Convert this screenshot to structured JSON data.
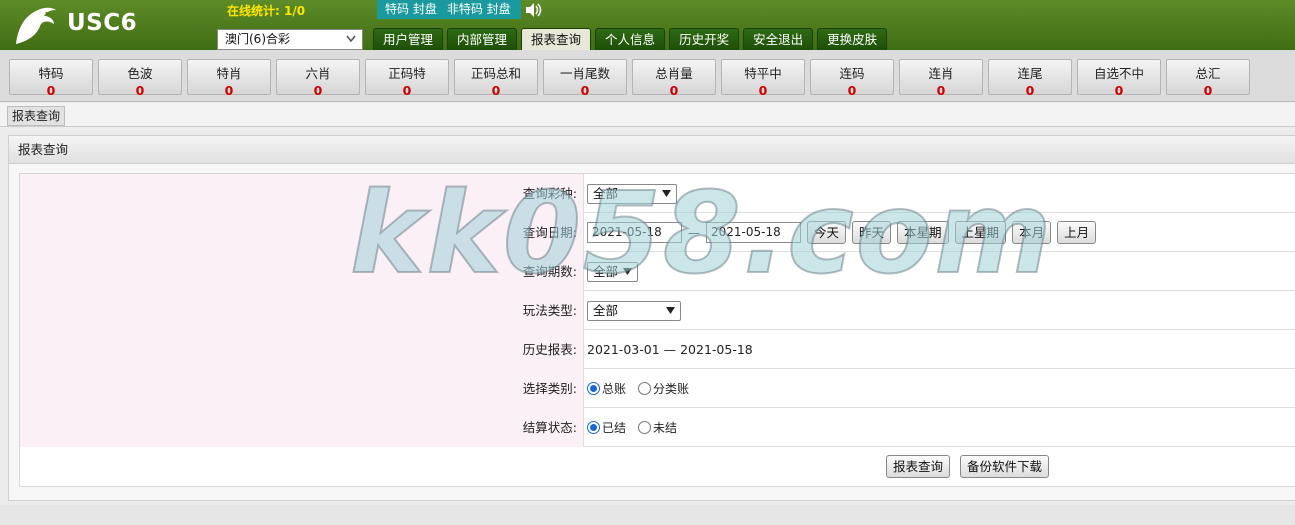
{
  "header": {
    "brand": "USC6",
    "online_label": "在线统计:",
    "online_value": "1/0",
    "status_items": [
      "特码 封盘",
      "非特码 封盘"
    ],
    "speaker_icon": "speaker-icon",
    "lottery_selected": "澳门(6)合彩",
    "nav": [
      "用户管理",
      "内部管理",
      "报表查询",
      "个人信息",
      "历史开奖",
      "安全退出",
      "更换皮肤"
    ],
    "nav_active_index": 2
  },
  "stats": [
    {
      "label": "特码",
      "value": "0"
    },
    {
      "label": "色波",
      "value": "0"
    },
    {
      "label": "特肖",
      "value": "0"
    },
    {
      "label": "六肖",
      "value": "0"
    },
    {
      "label": "正码特",
      "value": "0"
    },
    {
      "label": "正码总和",
      "value": "0"
    },
    {
      "label": "一肖尾数",
      "value": "0"
    },
    {
      "label": "总肖量",
      "value": "0"
    },
    {
      "label": "特平中",
      "value": "0"
    },
    {
      "label": "连码",
      "value": "0"
    },
    {
      "label": "连肖",
      "value": "0"
    },
    {
      "label": "连尾",
      "value": "0"
    },
    {
      "label": "自选不中",
      "value": "0"
    },
    {
      "label": "总汇",
      "value": "0"
    }
  ],
  "breadcrumb": "报表查询",
  "panel": {
    "title": "报表查询",
    "lottery_type_label": "查询彩种:",
    "lottery_type_value": "全部",
    "date_label": "查询日期:",
    "date_from": "2021-05-18",
    "date_sep": "—",
    "date_to": "2021-05-18",
    "date_buttons": [
      "今天",
      "昨天",
      "本星期",
      "上星期",
      "本月",
      "上月"
    ],
    "period_label": "查询期数:",
    "period_value": "全部",
    "play_type_label": "玩法类型:",
    "play_type_value": "全部",
    "history_label": "历史报表:",
    "history_value": "2021-03-01 — 2021-05-18",
    "category_label": "选择类别:",
    "category_options": [
      "总账",
      "分类账"
    ],
    "category_selected": 0,
    "settle_label": "结算状态:",
    "settle_options": [
      "已结",
      "未结"
    ],
    "settle_selected": 0,
    "submit_label": "报表查询",
    "backup_label": "备份软件下载"
  },
  "watermark": "kk058.com",
  "colors": {
    "header_green": "#4e7d1c",
    "accent_teal": "#1a9a9e",
    "online_yellow": "#ffe600",
    "stat_value_red": "#cc0000",
    "label_cell_pink": "#fbf0f5"
  }
}
